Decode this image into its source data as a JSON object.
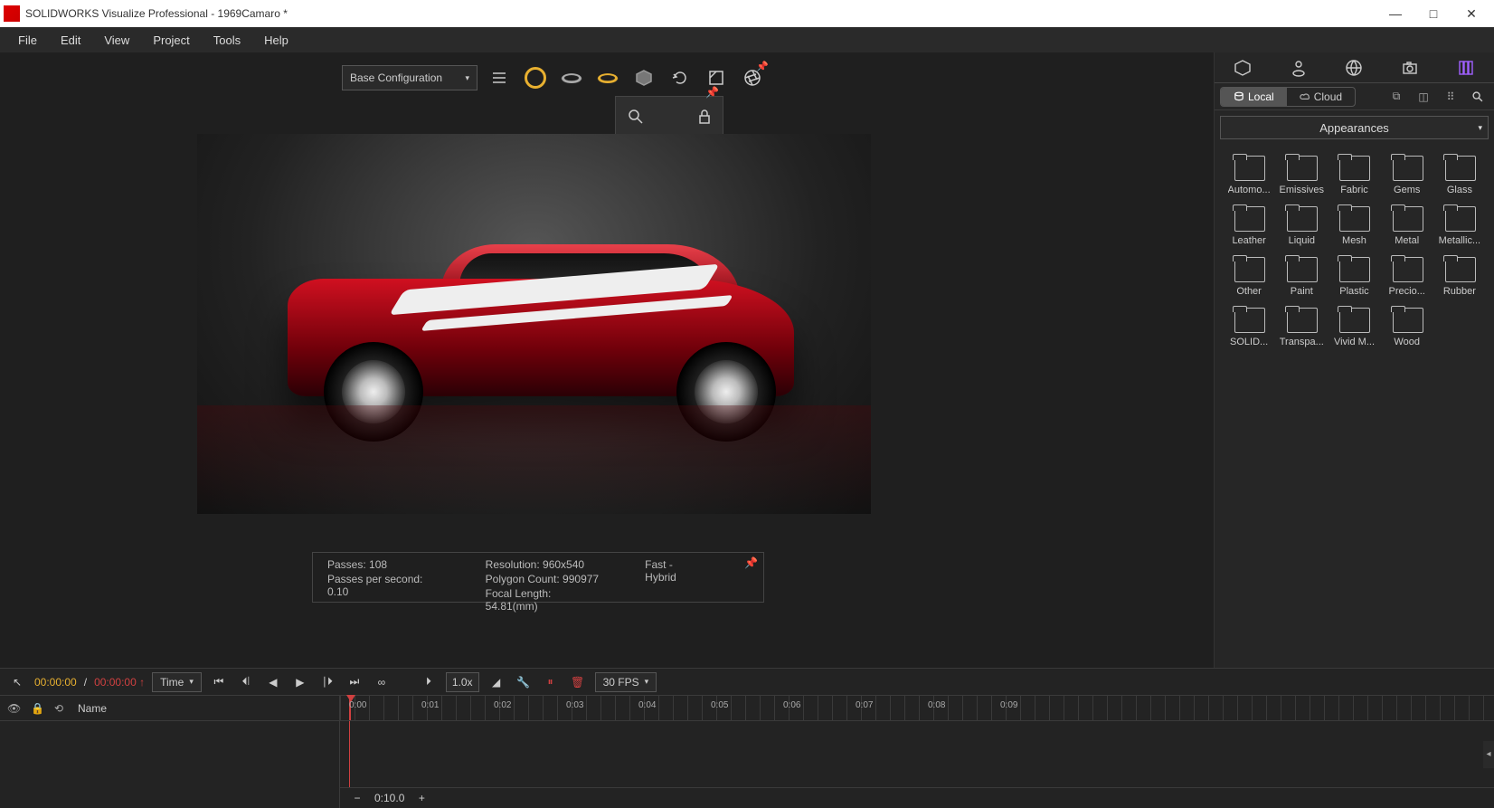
{
  "titlebar": {
    "app_title": "SOLIDWORKS Visualize Professional - 1969Camaro *"
  },
  "menubar": {
    "items": [
      "File",
      "Edit",
      "View",
      "Project",
      "Tools",
      "Help"
    ]
  },
  "toolbar": {
    "config_label": "Base Configuration"
  },
  "status": {
    "passes_label": "Passes: 108",
    "pps_label": "Passes per second: 0.10",
    "resolution_label": "Resolution: 960x540",
    "polycount_label": "Polygon Count: 990977",
    "focal_label": "Focal Length: 54.81(mm)",
    "mode_label": "Fast - Hybrid"
  },
  "right_panel": {
    "source": {
      "local": "Local",
      "cloud": "Cloud"
    },
    "category_label": "Appearances",
    "folders": [
      "Automo...",
      "Emissives",
      "Fabric",
      "Gems",
      "Glass",
      "Leather",
      "Liquid",
      "Mesh",
      "Metal",
      "Metallic...",
      "Other",
      "Paint",
      "Plastic",
      "Precio...",
      "Rubber",
      "SOLID...",
      "Transpa...",
      "Vivid M...",
      "Wood"
    ]
  },
  "timeline": {
    "timecode_current": "00:00:00",
    "timecode_sep": " / ",
    "timecode_total": "00:00:00 ↑",
    "mode_label": "Time",
    "speed_label": "1.0x",
    "fps_label": "30 FPS",
    "name_header": "Name",
    "zoom_time": "0:10.0",
    "ruler_ticks": [
      "0:00",
      "0:01",
      "0:02",
      "0:03",
      "0:04",
      "0:05",
      "0:06",
      "0:07",
      "0:08",
      "0:09"
    ]
  }
}
